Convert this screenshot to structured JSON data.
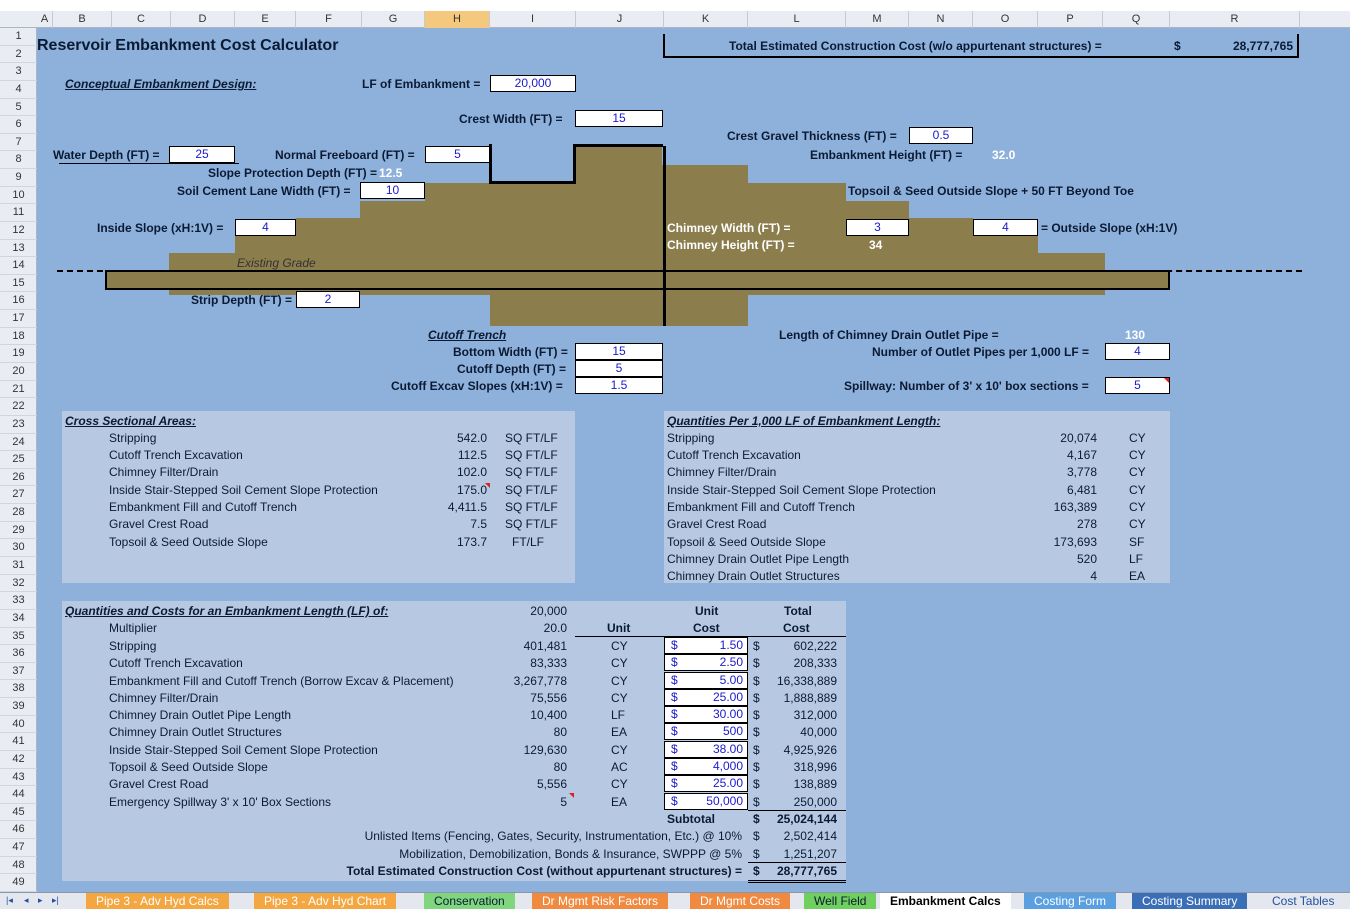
{
  "sheet": {
    "title": "Reservoir Embankment Cost Calculator",
    "total_label": "Total Estimated Construction Cost (w/o appurtenant structures) =",
    "total_currency": "$",
    "total_value": "28,777,765"
  },
  "columns": [
    "A",
    "B",
    "C",
    "D",
    "E",
    "F",
    "G",
    "H",
    "I",
    "J",
    "K",
    "L",
    "M",
    "N",
    "O",
    "P",
    "Q",
    "R"
  ],
  "rows": [
    "1",
    "2",
    "3",
    "4",
    "5",
    "6",
    "7",
    "8",
    "9",
    "10",
    "11",
    "12",
    "13",
    "14",
    "15",
    "16",
    "17",
    "18",
    "19",
    "20",
    "21",
    "22",
    "23",
    "24",
    "25",
    "26",
    "27",
    "28",
    "29",
    "30",
    "31",
    "32",
    "33",
    "34",
    "35",
    "36",
    "37",
    "38",
    "39",
    "40",
    "41",
    "42",
    "43",
    "44",
    "45",
    "46",
    "47",
    "48",
    "49"
  ],
  "design": {
    "heading": "Conceptual Embankment Design:",
    "lf_label": "LF of Embankment =",
    "lf_value": "20,000",
    "crest_width_label": "Crest Width (FT) =",
    "crest_width_value": "15",
    "crest_gravel_label": "Crest Gravel Thickness (FT) =",
    "crest_gravel_value": "0.5",
    "water_depth_label": "Water Depth (FT) =",
    "water_depth_value": "25",
    "freeboard_label": "Normal Freeboard (FT) =",
    "freeboard_value": "5",
    "emb_height_label": "Embankment Height (FT) =",
    "emb_height_value": "32.0",
    "slope_prot_label": "Slope Protection Depth (FT) =",
    "slope_prot_value": "12.5",
    "lane_width_label": "Soil Cement Lane Width (FT) =",
    "lane_width_value": "10",
    "topsoil_label": "Topsoil & Seed Outside Slope + 50 FT Beyond Toe",
    "inside_slope_label": "Inside Slope (xH:1V) =",
    "inside_slope_value": "4",
    "chimney_width_label": "Chimney Width (FT) =",
    "chimney_width_value": "3",
    "outside_slope_value": "4",
    "outside_slope_label": "= Outside Slope (xH:1V)",
    "chimney_height_label": "Chimney Height (FT) =",
    "chimney_height_value": "34",
    "existing_grade": "Existing Grade",
    "strip_depth_label": "Strip Depth (FT) =",
    "strip_depth_value": "2",
    "cutoff_heading": "Cutoff Trench",
    "bottom_width_label": "Bottom Width (FT) =",
    "bottom_width_value": "15",
    "cutoff_depth_label": "Cutoff Depth (FT) =",
    "cutoff_depth_value": "5",
    "cutoff_slopes_label": "Cutoff Excav Slopes (xH:1V) =",
    "cutoff_slopes_value": "1.5",
    "drain_length_label": "Length of Chimney Drain Outlet Pipe =",
    "drain_length_value": "130",
    "outlet_pipes_label": "Number of Outlet Pipes per 1,000 LF =",
    "outlet_pipes_value": "4",
    "spillway_label": "Spillway: Number of 3' x 10' box sections =",
    "spillway_value": "5"
  },
  "areas": {
    "heading": "Cross Sectional Areas:",
    "items": [
      {
        "label": "Stripping",
        "value": "542.0",
        "unit": "SQ FT/LF"
      },
      {
        "label": "Cutoff Trench Excavation",
        "value": "112.5",
        "unit": "SQ FT/LF"
      },
      {
        "label": "Chimney Filter/Drain",
        "value": "102.0",
        "unit": "SQ FT/LF"
      },
      {
        "label": "Inside Stair-Stepped Soil Cement Slope Protection",
        "value": "175.0",
        "unit": "SQ FT/LF"
      },
      {
        "label": "Embankment Fill and Cutoff Trench",
        "value": "4,411.5",
        "unit": "SQ FT/LF"
      },
      {
        "label": "Gravel Crest Road",
        "value": "7.5",
        "unit": "SQ FT/LF"
      },
      {
        "label": "Topsoil & Seed Outside Slope",
        "value": "173.7",
        "unit": "FT/LF"
      }
    ]
  },
  "perk": {
    "heading": "Quantities Per 1,000 LF of Embankment Length:",
    "items": [
      {
        "label": "Stripping",
        "value": "20,074",
        "unit": "CY"
      },
      {
        "label": "Cutoff Trench Excavation",
        "value": "4,167",
        "unit": "CY"
      },
      {
        "label": "Chimney Filter/Drain",
        "value": "3,778",
        "unit": "CY"
      },
      {
        "label": "Inside Stair-Stepped Soil Cement Slope Protection",
        "value": "6,481",
        "unit": "CY"
      },
      {
        "label": "Embankment Fill and Cutoff Trench",
        "value": "163,389",
        "unit": "CY"
      },
      {
        "label": "Gravel Crest Road",
        "value": "278",
        "unit": "CY"
      },
      {
        "label": "Topsoil & Seed Outside Slope",
        "value": "173,693",
        "unit": "SF"
      },
      {
        "label": "Chimney Drain Outlet Pipe Length",
        "value": "520",
        "unit": "LF"
      },
      {
        "label": "Chimney Drain Outlet Structures",
        "value": "4",
        "unit": "EA"
      }
    ]
  },
  "costs": {
    "heading": "Quantities and Costs for an Embankment Length (LF) of:",
    "length": "20,000",
    "multiplier_label": "Multiplier",
    "multiplier": "20.0",
    "hdr_unit": "Unit",
    "hdr_unit_cost_1": "Unit",
    "hdr_unit_cost_2": "Cost",
    "hdr_total_1": "Total",
    "hdr_total_2": "Cost",
    "items": [
      {
        "label": "Stripping",
        "qty": "401,481",
        "unit": "CY",
        "price": "1.50",
        "total": "602,222"
      },
      {
        "label": "Cutoff Trench Excavation",
        "qty": "83,333",
        "unit": "CY",
        "price": "2.50",
        "total": "208,333"
      },
      {
        "label": "Embankment Fill and Cutoff Trench (Borrow Excav & Placement)",
        "qty": "3,267,778",
        "unit": "CY",
        "price": "5.00",
        "total": "16,338,889"
      },
      {
        "label": "Chimney Filter/Drain",
        "qty": "75,556",
        "unit": "CY",
        "price": "25.00",
        "total": "1,888,889"
      },
      {
        "label": "Chimney Drain Outlet Pipe Length",
        "qty": "10,400",
        "unit": "LF",
        "price": "30.00",
        "total": "312,000"
      },
      {
        "label": "Chimney Drain Outlet Structures",
        "qty": "80",
        "unit": "EA",
        "price": "500",
        "total": "40,000"
      },
      {
        "label": "Inside Stair-Stepped Soil Cement Slope Protection",
        "qty": "129,630",
        "unit": "CY",
        "price": "38.00",
        "total": "4,925,926"
      },
      {
        "label": "Topsoil & Seed Outside Slope",
        "qty": "80",
        "unit": "AC",
        "price": "4,000",
        "total": "318,996"
      },
      {
        "label": "Gravel Crest Road",
        "qty": "5,556",
        "unit": "CY",
        "price": "25.00",
        "total": "138,889"
      },
      {
        "label": "Emergency Spillway 3' x 10' Box Sections",
        "qty": "5",
        "unit": "EA",
        "price": "50,000",
        "total": "250,000"
      }
    ],
    "subtotal_label": "Subtotal",
    "subtotal": "25,024,144",
    "unlisted_label": "Unlisted Items (Fencing, Gates, Security, Instrumentation, Etc.) @ 10%",
    "unlisted": "2,502,414",
    "mobil_label": "Mobilization, Demobilization, Bonds & Insurance, SWPPP @ 5%",
    "mobil": "1,251,207",
    "total_label": "Total Estimated Construction Cost (without appurtenant structures) =",
    "total": "28,777,765",
    "currency": "$"
  },
  "tabs": [
    {
      "label": "Pipe 3 - Adv Hyd Calcs",
      "color": "#f4a640"
    },
    {
      "label": "Pipe 3 - Adv Hyd Chart",
      "color": "#f4a640"
    },
    {
      "label": "Conservation",
      "color": "#7fd67f"
    },
    {
      "label": "Dr Mgmt Risk Factors",
      "color": "#f08a40"
    },
    {
      "label": "Dr Mgmt Costs",
      "color": "#f08a40"
    },
    {
      "label": "Well Field",
      "color": "#6fcf5f"
    },
    {
      "label": "Embankment Calcs",
      "color": "#ffffff"
    },
    {
      "label": "Costing Form",
      "color": "#5aa0e0"
    },
    {
      "label": "Costing Summary",
      "color": "#3a6fb8"
    },
    {
      "label": "Cost Tables",
      "color": "#e4e8ee"
    }
  ],
  "nav": [
    "|◂",
    "◂",
    "▸",
    "▸|"
  ]
}
